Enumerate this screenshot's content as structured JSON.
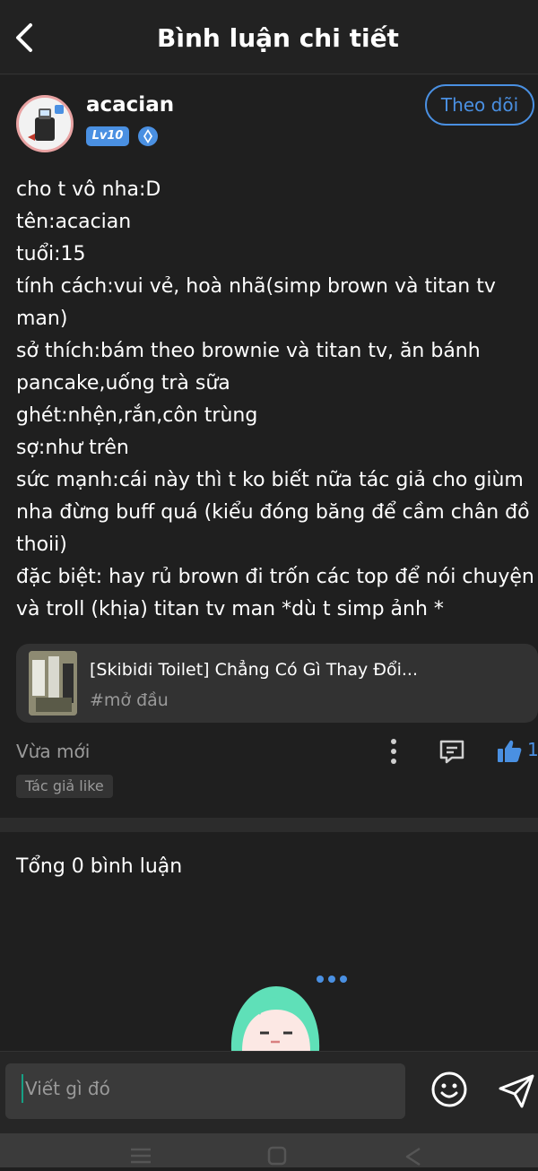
{
  "header": {
    "title": "Bình luận chi tiết"
  },
  "post": {
    "username": "acacian",
    "level": "Lv10",
    "follow_label": "Theo dõi",
    "content": "cho t vô nha:D\ntên:acacian\ntuổi:15\ntính cách:vui vẻ, hoà nhã(simp brown và titan tv\nman)\nsở thích:bám theo brownie và titan tv, ăn bánh\npancake,uống trà sữa\nghét:nhện,rắn,côn trùng\nsợ:như trên\nsức mạnh:cái này thì t ko biết nữa tác giả cho giùm\nnha đừng buff quá (kiểu đóng băng để cầm chân đồ\nthoii)\nđặc biệt: hay rủ brown đi trốn các top để nói chuyện\nvà troll (khịa) titan tv man *dù t simp ảnh *",
    "link_card": {
      "title": "[Skibidi Toilet] Chẳng Có Gì Thay Đổi...",
      "tag": "#mở đầu"
    },
    "time": "Vừa mới",
    "like_count": "1",
    "author_like": "Tác giả like"
  },
  "comments": {
    "total_label": "Tổng 0 bình luận"
  },
  "composer": {
    "placeholder": "Viết gì đó"
  },
  "colors": {
    "accent": "#4a90e2",
    "background": "#1f1f1f",
    "mascot_hair": "#5fe0b8"
  },
  "icons": [
    "back-icon",
    "rank-icon",
    "more-icon",
    "comment-icon",
    "like-icon",
    "emoji-icon",
    "send-icon",
    "menu-icon",
    "home-icon",
    "nav-back-icon"
  ]
}
